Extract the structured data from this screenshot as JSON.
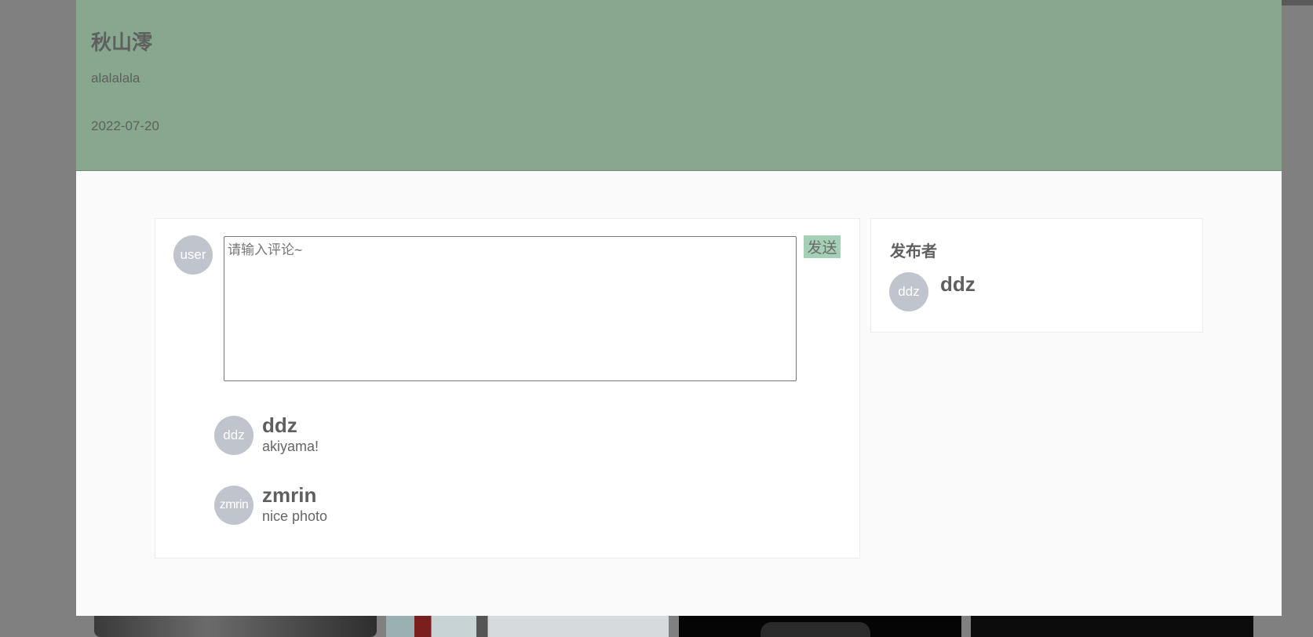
{
  "post": {
    "title": "秋山澪",
    "description": "alalalala",
    "date": "2022-07-20"
  },
  "comment_form": {
    "user_avatar_label": "user",
    "placeholder": "请输入评论~",
    "send_label": "发送"
  },
  "comments": [
    {
      "avatar_label": "ddz",
      "author": "ddz",
      "text": "akiyama!"
    },
    {
      "avatar_label": "zmrin",
      "author": "zmrin",
      "text": "nice photo"
    }
  ],
  "publisher": {
    "heading": "发布者",
    "avatar_label": "ddz",
    "name": "ddz"
  },
  "colors": {
    "header_bg": "#87a78e",
    "send_button_bg": "#a6d0b5",
    "avatar_bg": "#c0c4cc",
    "overlay": "#808080"
  }
}
